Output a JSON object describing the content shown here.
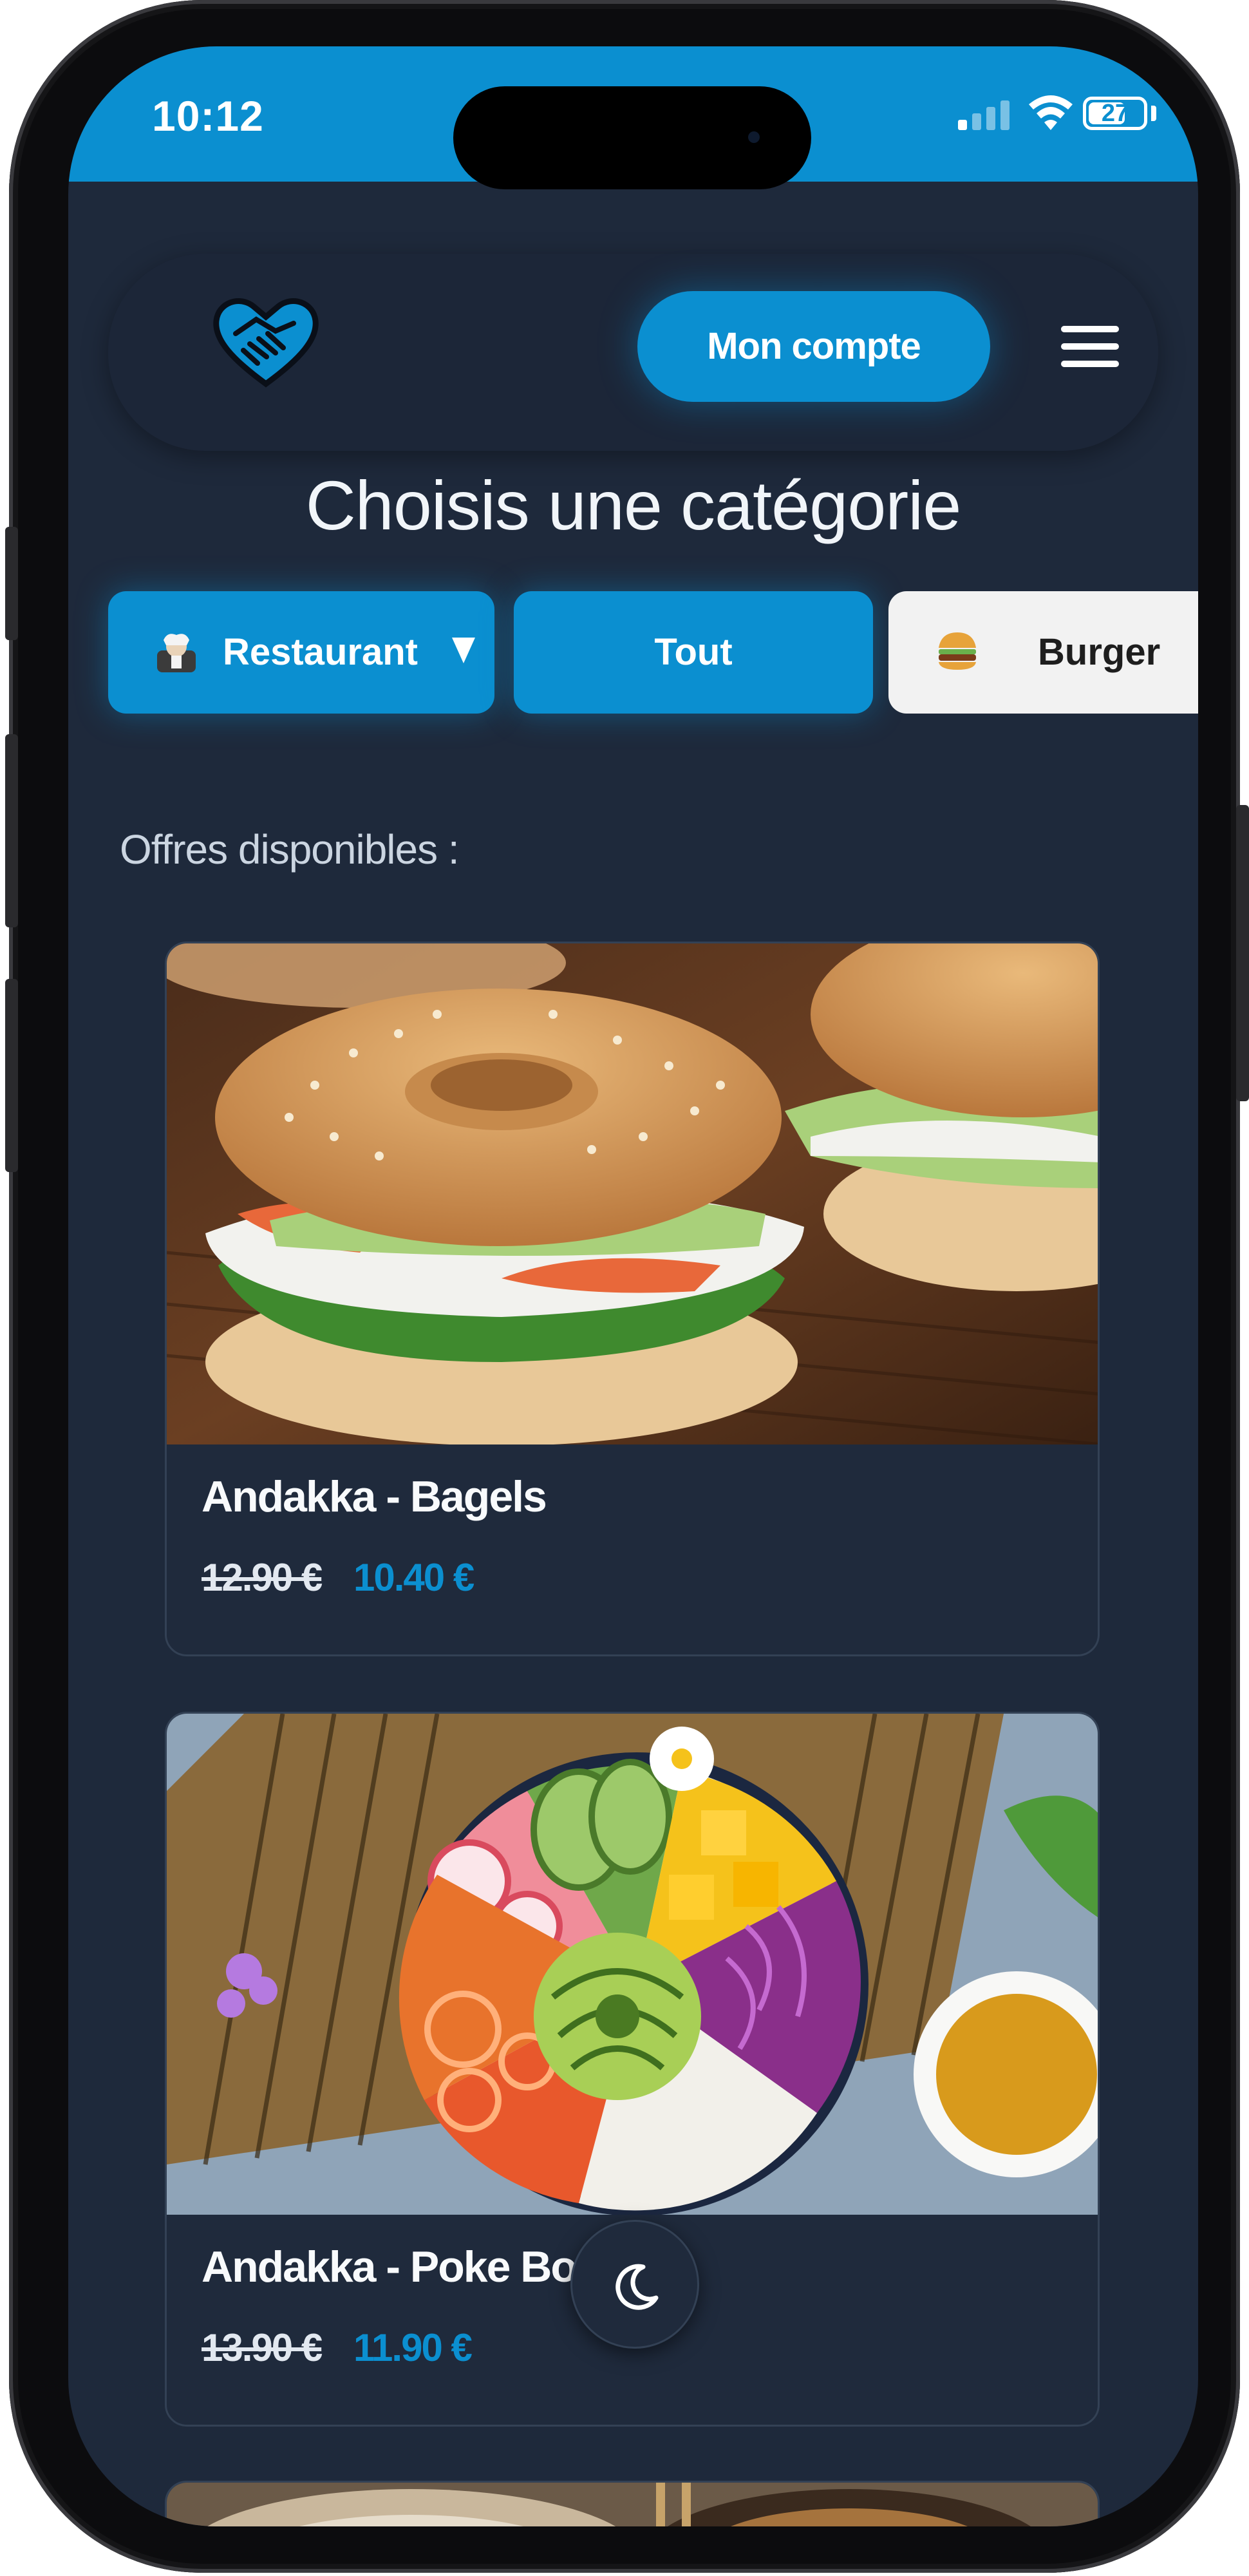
{
  "status_bar": {
    "time": "10:12",
    "battery": "27",
    "icons": [
      "signal-icon",
      "wifi-icon",
      "battery-icon"
    ]
  },
  "header": {
    "logo_icon": "heart-handshake-icon",
    "account_label": "Mon compte",
    "menu_icon": "hamburger-menu-icon"
  },
  "title": "Choisis une catégorie",
  "categories": [
    {
      "label": "Restaurant",
      "icon": "chef-icon",
      "has_dropdown": true
    },
    {
      "label": "Tout"
    },
    {
      "label": "Burger",
      "icon": "burger-icon"
    }
  ],
  "offers_label": "Offres disponibles :",
  "offers": [
    {
      "name": "Andakka - Bagels",
      "old_price": "12.90 €",
      "new_price": "10.40 €",
      "image": "bagel-photo"
    },
    {
      "name": "Andakka - Poke Bow",
      "old_price": "13.90 €",
      "new_price": "11.90 €",
      "image": "poke-bowl-photo"
    },
    {
      "image": "third-offer-photo"
    }
  ],
  "theme_toggle_icon": "moon-icon",
  "colors": {
    "accent": "#0b8fd0",
    "background": "#1e293b",
    "card": "#1f2a3c"
  }
}
